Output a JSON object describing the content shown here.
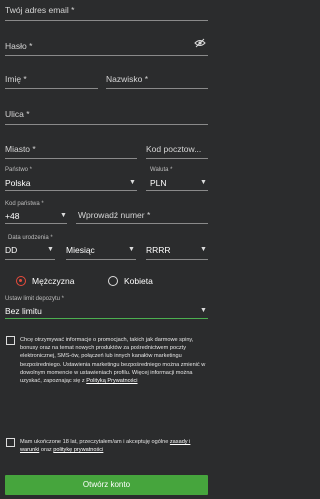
{
  "form": {
    "email_placeholder": "Twój adres email *",
    "password_placeholder": "Hasło *",
    "first_name_placeholder": "Imię *",
    "last_name_placeholder": "Nazwisko *",
    "street_placeholder": "Ulica *",
    "city_placeholder": "Miasto *",
    "postcode_placeholder": "Kod pocztow...",
    "country_label": "Państwo *",
    "country_value": "Polska",
    "currency_label": "Waluta *",
    "currency_value": "PLN",
    "phone_code_label": "Kod państwa *",
    "phone_code_value": "+48",
    "phone_placeholder": "Wprowadź numer *",
    "dob_label": "Data urodzenia *",
    "dob_day": "DD",
    "dob_month": "Miesiąc",
    "dob_year": "RRRR",
    "gender_male": "Mężczyzna",
    "gender_female": "Kobieta",
    "selected_gender": "male",
    "deposit_label": "Ustaw limit depozytu *",
    "deposit_value": "Bez limitu",
    "marketing_text": "Chcę otrzymywać informacje o promocjach, takich jak darmowe spiny, bonusy oraz na temat nowych produktów za pośrednictwem poczty elektronicznej, SMS-ów, połączeń lub innych kanałów marketingu bezpośredniego. Ustawienia marketingu bezpośredniego można zmienić w dowolnym momencie w ustawieniach profilu. Więcej informacji można uzyskać, zapoznając się z",
    "privacy_link": "Polityką Prywatności",
    "age_text_1": "Mam ukończone 18 lat, przeczytałem/am i akceptuję ogólne",
    "terms_link": "zasady i warunki",
    "age_text_2": "oraz",
    "privacy_link_2": "politykę prywatności",
    "submit_label": "Otwórz konto"
  },
  "icons": {
    "password_toggle": "eye-slash-icon",
    "dropdown": "caret-down-icon"
  },
  "colors": {
    "background": "#2b2c2d",
    "accent_red": "#e64b3c",
    "button_green": "#46a53d",
    "deposit_underline": "#4caf50"
  }
}
